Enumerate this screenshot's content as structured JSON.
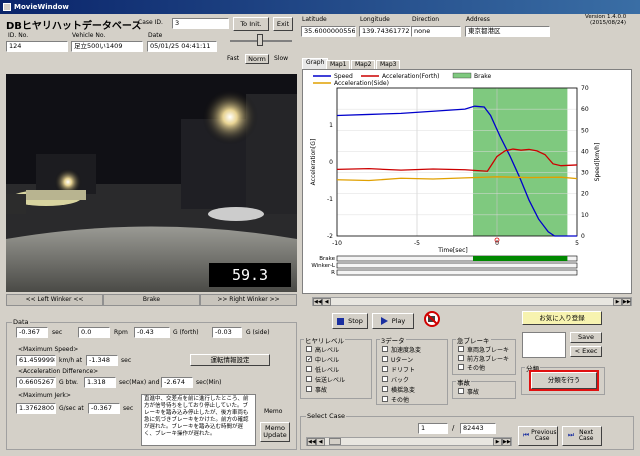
{
  "window": {
    "title": "MovieWindow"
  },
  "header": {
    "app_title": "DBヒヤリハットデータベース",
    "case_id_label": "Case ID.",
    "case_id_value": "3",
    "to_init_label": "To Init.",
    "exit_label": "Exit",
    "latitude_label": "Latitude",
    "latitude_value": "35.6000000556",
    "longitude_label": "Longitude",
    "longitude_value": "139.743617728",
    "direction_label": "Direction",
    "direction_value": "none",
    "address_label": "Address",
    "address_value": "東京都港区",
    "version_line1": "Version 1.4.0.0",
    "version_line2": "(2015/08/24)",
    "id_no_label": "ID. No.",
    "id_no_value": "124",
    "vehicle_no_label": "Vehicle No.",
    "vehicle_no_value": "足立500い1409",
    "date_label": "Date",
    "date_value": "05/01/25 04:41:11",
    "speed_fast": "Fast",
    "speed_norm": "Norm",
    "speed_slow": "Slow"
  },
  "video": {
    "speed_readout": "59.3",
    "left_winker": "<< Left Winker <<",
    "brake": "Brake",
    "right_winker": ">> Right Winker >>"
  },
  "data_panel": {
    "group_label": "Data",
    "row1_value1": "-0.367",
    "row1_unit1": "sec",
    "row1_value2": "0.0",
    "row1_unit2": "Rpm",
    "row1_value3": "-0.43",
    "row1_unit3": "G (forth)",
    "row1_value4": "-0.03",
    "row1_unit4": "G (side)",
    "max_speed_label": "<Maximum Speed>",
    "max_speed_value": "61.4599998",
    "max_speed_unit": "km/h at",
    "max_speed_time": "-1.348",
    "max_speed_time_unit": "sec",
    "accel_diff_label": "<Acceleration Difference>",
    "accel_diff_value": "0.6605267",
    "accel_diff_unit": "G btw.",
    "accel_diff_t1": "1.318",
    "accel_diff_mid": "sec(Max) and",
    "accel_diff_t2": "-2.674",
    "accel_diff_end": "sec(Min)",
    "max_jerk_label": "<Maximum Jerk>",
    "max_jerk_value": "1.3762800",
    "max_jerk_unit": "G/sec at",
    "max_jerk_time": "-0.367",
    "max_jerk_time_unit": "sec",
    "info_button": "運転情報設定",
    "memo_text": "直進中、交差点を前に進行したところ、前方が信号待ちをしており停止していた。ブレーキを踏み込み停止したが、後方車両も急に気づきブレーキをかけた。前方の確認が遅れた。ブレーキを踏み込む時間が遅く、ブレーキ操作が遅れた。",
    "memo_label": "Memo",
    "memo_update": "Memo Update"
  },
  "graph_panel": {
    "tabs": [
      "Graph",
      "Map1",
      "Map2",
      "Map3"
    ],
    "active_tab": "Graph",
    "track_labels": [
      "Brake",
      "Winker-L",
      "R"
    ]
  },
  "chart_data": {
    "type": "line",
    "xlabel": "Time[sec]",
    "ylabel_left": "Acceleration[G]",
    "ylabel_right": "Speed[km/h]",
    "xlim": [
      -10,
      5
    ],
    "ylim_left": [
      -2,
      2
    ],
    "ylim_right": [
      0,
      70
    ],
    "x_ticks": [
      "-10",
      "-5",
      "0",
      "5"
    ],
    "y_ticks_left": [
      "-2",
      "-1",
      "0",
      "1"
    ],
    "y_ticks_right": [
      "0",
      "10",
      "20",
      "30",
      "40",
      "50",
      "60",
      "70"
    ],
    "legend": [
      "Speed",
      "Acceleration(Forth)",
      "Acceleration(Side)",
      "Brake"
    ],
    "brake_interval": [
      -1.5,
      4.4
    ],
    "series": [
      {
        "name": "Speed",
        "color": "#0000cc",
        "axis": "right",
        "x": [
          -10,
          -8,
          -6,
          -4,
          -2,
          -1.4,
          -0.8,
          -0.4,
          0.2,
          0.8,
          1.4,
          2.0,
          2.6,
          3.2,
          3.6,
          5
        ],
        "values": [
          57,
          57.5,
          58,
          59,
          60,
          61.4,
          61,
          57,
          47,
          38,
          28,
          17,
          8,
          2,
          0,
          0
        ]
      },
      {
        "name": "Acceleration(Forth)",
        "color": "#cc0000",
        "axis": "left",
        "x": [
          -10,
          -8,
          -6,
          -4,
          -2,
          -0.6,
          -0.3,
          0,
          0.5,
          1.0,
          1.5,
          2.0,
          2.5,
          3.0,
          3.5,
          4.0,
          5
        ],
        "values": [
          -0.2,
          -0.18,
          -0.22,
          -0.19,
          -0.21,
          -0.25,
          -0.05,
          0.15,
          0.3,
          0.35,
          0.32,
          0.34,
          0.3,
          0.2,
          -0.05,
          -0.1,
          -0.08
        ]
      },
      {
        "name": "Acceleration(Side)",
        "color": "#e0a000",
        "axis": "left",
        "x": [
          -10,
          -8,
          -6,
          -4,
          -2,
          0,
          2,
          4,
          5
        ],
        "values": [
          -0.48,
          -0.5,
          -0.44,
          -0.46,
          -0.43,
          -0.4,
          -0.42,
          -0.41,
          -0.45
        ]
      }
    ]
  },
  "controls": {
    "stop_label": "Stop",
    "play_label": "Play",
    "favorite_button": "お気に入り登録",
    "save_label": "Save",
    "exec_label": "< Exec",
    "bunrui_label": "分類",
    "bunrui_button": "分類を行う"
  },
  "filters": {
    "hiyari_label": "ヒヤリレベル",
    "hiyari_items": [
      "高レベル",
      "中レベル",
      "低レベル",
      "伝送レベル",
      "事故"
    ],
    "hiyari_checked": [
      false,
      true,
      false,
      false,
      false
    ],
    "three_data_label": "3データ",
    "three_data_items": [
      "加速度急変",
      "Uターン",
      "ドリフト",
      "バック",
      "横揺急変",
      "その他"
    ],
    "brake_label": "急ブレーキ",
    "brake_items": [
      "車両急ブレーキ",
      "前方急ブレーキ",
      "その他"
    ],
    "jiko_label": "事故",
    "jiko_items": [
      "事故"
    ]
  },
  "select_case": {
    "label": "Select Case",
    "current": "1",
    "total": "82443",
    "prev_label": "Previous Case",
    "next_label": "Next Case"
  }
}
